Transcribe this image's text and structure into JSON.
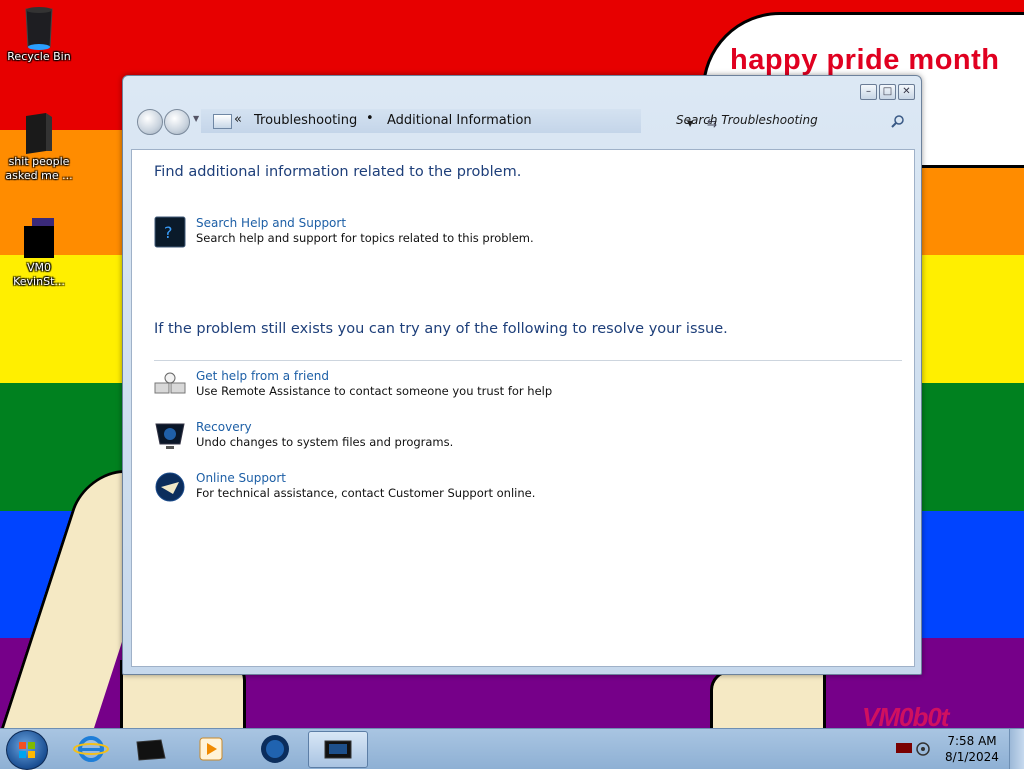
{
  "desktop": {
    "banner_text": "happy pride month",
    "watermark": "VM0b0t",
    "icons": [
      {
        "label": "Recycle Bin",
        "icon": "recycle-bin-icon"
      },
      {
        "label": "shit people asked me ...",
        "icon": "folder-icon"
      },
      {
        "label": "VM0 KevinSt...",
        "icon": "file-icon"
      }
    ]
  },
  "window": {
    "breadcrumb": [
      "Troubleshooting",
      "Additional Information"
    ],
    "breadcrumb_overflow": "«",
    "search_placeholder": "Search Troubleshooting",
    "controls": {
      "minimize": "minimize-icon",
      "maximize": "maximize-icon",
      "close": "close-icon"
    },
    "section1": {
      "heading": "Find additional information related to the problem.",
      "items": [
        {
          "title": "Search Help and Support",
          "description": "Search help and support for topics related to this problem.",
          "icon": "help-support-icon"
        }
      ]
    },
    "section2": {
      "heading": "If the problem still exists you can try any of the following to resolve your issue.",
      "items": [
        {
          "title": "Get help from a friend",
          "description": "Use Remote Assistance to contact someone you trust for help",
          "icon": "remote-assistance-icon"
        },
        {
          "title": "Recovery",
          "description": "Undo changes to system files and programs.",
          "icon": "recovery-icon"
        },
        {
          "title": "Online Support",
          "description": "For technical assistance, contact Customer Support online.",
          "icon": "online-support-icon"
        }
      ]
    }
  },
  "taskbar": {
    "pinned": [
      "internet-explorer-icon",
      "notebook-icon",
      "media-player-icon",
      "globe-icon",
      "troubleshooting-window-icon"
    ],
    "time": "7:58 AM",
    "date": "8/1/2024"
  },
  "colors": {
    "link": "#1d5fa6",
    "heading": "#1e3f7a",
    "banner": "#e00020"
  }
}
